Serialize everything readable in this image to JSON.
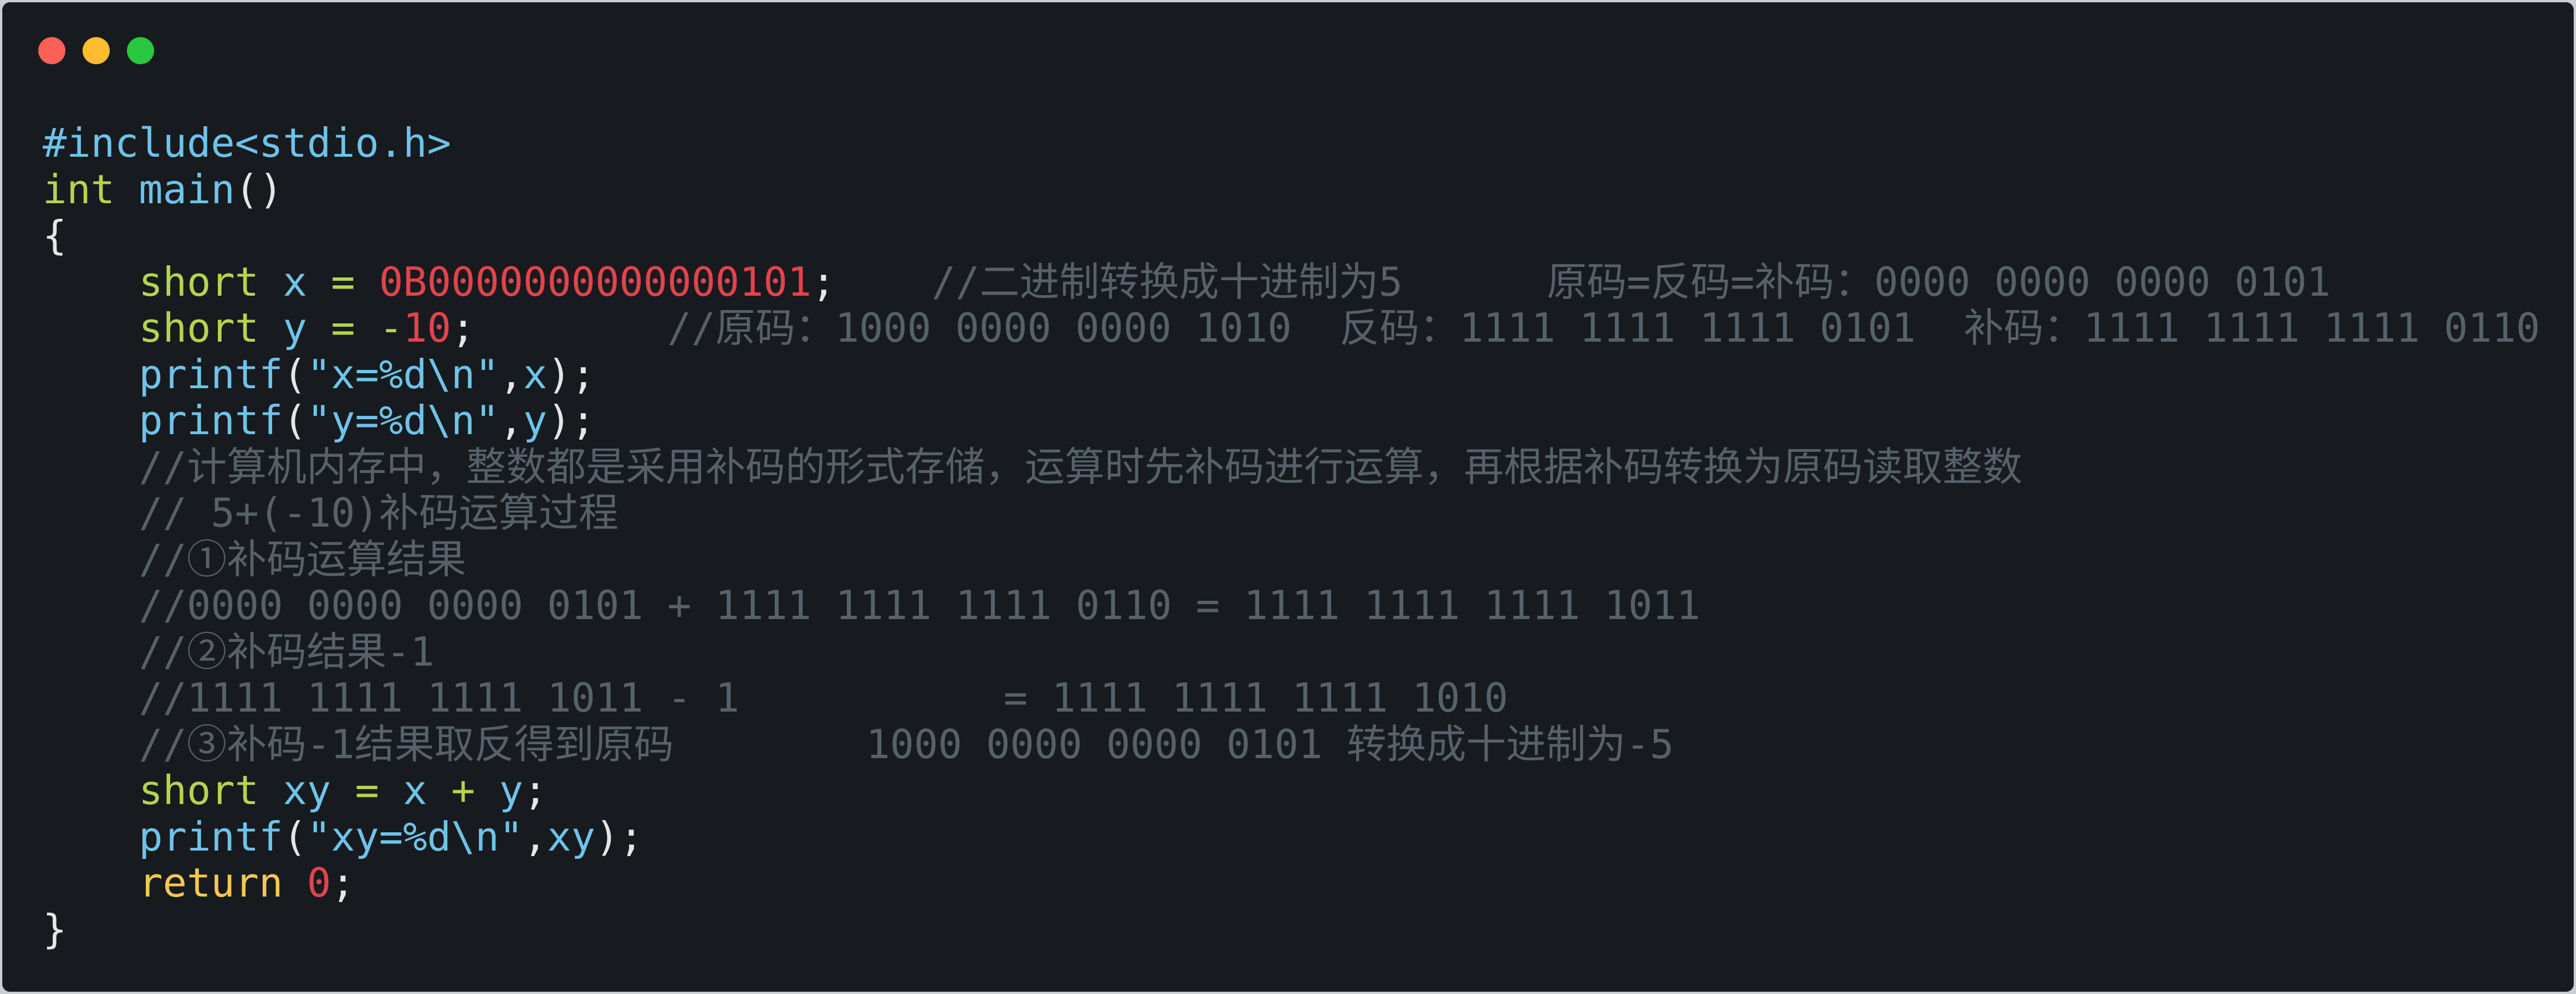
{
  "window": {
    "controls": [
      "close",
      "minimize",
      "zoom"
    ],
    "colors": {
      "close": "#fe5f57",
      "minimize": "#febc2e",
      "zoom": "#28c840",
      "background": "#171b1f"
    }
  },
  "code": {
    "lines": [
      [
        {
          "t": "#include<stdio.h>",
          "c": "pre"
        }
      ],
      [
        {
          "t": "int",
          "c": "kw"
        },
        {
          "t": " ",
          "c": "punc"
        },
        {
          "t": "main",
          "c": "func"
        },
        {
          "t": "()",
          "c": "punc"
        }
      ],
      [
        {
          "t": "{",
          "c": "punc"
        }
      ],
      [
        {
          "t": "    ",
          "c": "punc"
        },
        {
          "t": "short",
          "c": "kw"
        },
        {
          "t": " ",
          "c": "punc"
        },
        {
          "t": "x",
          "c": "id"
        },
        {
          "t": " ",
          "c": "punc"
        },
        {
          "t": "=",
          "c": "op"
        },
        {
          "t": " ",
          "c": "punc"
        },
        {
          "t": "0B0000000000000101",
          "c": "num"
        },
        {
          "t": ";",
          "c": "punc"
        },
        {
          "t": "    //二进制转换成十进制为5      原码=反码=补码：0000 0000 0000 0101",
          "c": "cm"
        }
      ],
      [
        {
          "t": "    ",
          "c": "punc"
        },
        {
          "t": "short",
          "c": "kw"
        },
        {
          "t": " ",
          "c": "punc"
        },
        {
          "t": "y",
          "c": "id"
        },
        {
          "t": " ",
          "c": "punc"
        },
        {
          "t": "=",
          "c": "op"
        },
        {
          "t": " ",
          "c": "punc"
        },
        {
          "t": "-",
          "c": "op"
        },
        {
          "t": "10",
          "c": "num"
        },
        {
          "t": ";",
          "c": "punc"
        },
        {
          "t": "        //原码：1000 0000 0000 1010  反码：1111 1111 1111 0101  补码：1111 1111 1111 0110",
          "c": "cm"
        }
      ],
      [
        {
          "t": "    ",
          "c": "punc"
        },
        {
          "t": "printf",
          "c": "func"
        },
        {
          "t": "(",
          "c": "punc"
        },
        {
          "t": "\"x=%d\\n\"",
          "c": "str"
        },
        {
          "t": ",",
          "c": "punc"
        },
        {
          "t": "x",
          "c": "id"
        },
        {
          "t": ");",
          "c": "punc"
        }
      ],
      [
        {
          "t": "    ",
          "c": "punc"
        },
        {
          "t": "printf",
          "c": "func"
        },
        {
          "t": "(",
          "c": "punc"
        },
        {
          "t": "\"y=%d\\n\"",
          "c": "str"
        },
        {
          "t": ",",
          "c": "punc"
        },
        {
          "t": "y",
          "c": "id"
        },
        {
          "t": ");",
          "c": "punc"
        }
      ],
      [
        {
          "t": "    //计算机内存中，整数都是采用补码的形式存储，运算时先补码进行运算，再根据补码转换为原码读取整数",
          "c": "cm"
        }
      ],
      [
        {
          "t": "    // 5+(-10)补码运算过程",
          "c": "cm"
        }
      ],
      [
        {
          "t": "    //①补码运算结果",
          "c": "cm"
        }
      ],
      [
        {
          "t": "    //0000 0000 0000 0101 + 1111 1111 1111 0110 = 1111 1111 1111 1011",
          "c": "cm"
        }
      ],
      [
        {
          "t": "    //②补码结果-1",
          "c": "cm"
        }
      ],
      [
        {
          "t": "    //1111 1111 1111 1011 - 1           = 1111 1111 1111 1010",
          "c": "cm"
        }
      ],
      [
        {
          "t": "    //③补码-1结果取反得到原码        1000 0000 0000 0101 转换成十进制为-5",
          "c": "cm"
        }
      ],
      [
        {
          "t": "    ",
          "c": "punc"
        },
        {
          "t": "short",
          "c": "kw"
        },
        {
          "t": " ",
          "c": "punc"
        },
        {
          "t": "xy",
          "c": "id"
        },
        {
          "t": " ",
          "c": "punc"
        },
        {
          "t": "=",
          "c": "op"
        },
        {
          "t": " ",
          "c": "punc"
        },
        {
          "t": "x",
          "c": "id"
        },
        {
          "t": " ",
          "c": "punc"
        },
        {
          "t": "+",
          "c": "op"
        },
        {
          "t": " ",
          "c": "punc"
        },
        {
          "t": "y",
          "c": "id"
        },
        {
          "t": ";",
          "c": "punc"
        }
      ],
      [
        {
          "t": "    ",
          "c": "punc"
        },
        {
          "t": "printf",
          "c": "func"
        },
        {
          "t": "(",
          "c": "punc"
        },
        {
          "t": "\"xy=%d\\n\"",
          "c": "str"
        },
        {
          "t": ",",
          "c": "punc"
        },
        {
          "t": "xy",
          "c": "id"
        },
        {
          "t": ");",
          "c": "punc"
        }
      ],
      [
        {
          "t": "    ",
          "c": "punc"
        },
        {
          "t": "return",
          "c": "ret"
        },
        {
          "t": " ",
          "c": "punc"
        },
        {
          "t": "0",
          "c": "num"
        },
        {
          "t": ";",
          "c": "punc"
        }
      ],
      [
        {
          "t": "}",
          "c": "punc"
        }
      ]
    ]
  }
}
